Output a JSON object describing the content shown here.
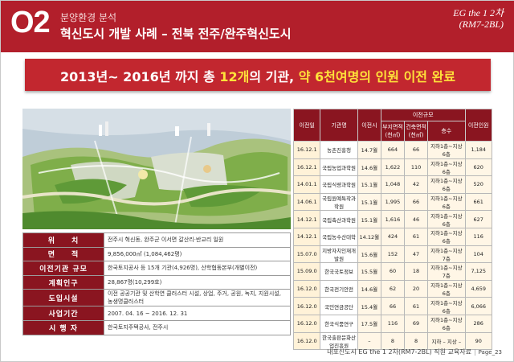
{
  "header": {
    "section_number": "O2",
    "section_subtitle": "분양환경 분석",
    "section_title": "혁신도시 개발 사례 – 전북 전주/완주혁신도시",
    "doc_code_line1": "EG the 1 2차",
    "doc_code_line2": "(RM7-2BL)"
  },
  "headline": {
    "part1": "2013년~ 2016년 까지 총 ",
    "highlight1": "12개",
    "part2": "의 기관, ",
    "highlight2": "약 6천여명의 인원  이전 완료"
  },
  "info_table": [
    {
      "label": "위　　치",
      "value": "전주시 혁신동, 완주군 이서면 갈산리·반교리 일원"
    },
    {
      "label": "면　　적",
      "value": "9,856,000㎡ (1,084,462평)"
    },
    {
      "label": "이전기관 규모",
      "value": "한국토지공사 등 15개 기관(4,926명), 산학협동본부(개별이전)"
    },
    {
      "label": "계획인구",
      "value": "28,867명(10,299호)"
    },
    {
      "label": "도입시설",
      "value": "이전 공공기관 및 산학연 클러스터 시설, 상업, 주거, 공원, 녹지, 지원시설, 농생명클러스터"
    },
    {
      "label": "사업기간",
      "value": "2007. 04. 16 ~ 2016. 12. 31"
    },
    {
      "label": "시 행 자",
      "value": "한국토지주택공사, 전주시"
    }
  ],
  "agency_table": {
    "headers": {
      "move_date": "이전일",
      "agency": "기관명",
      "move_year": "이전시",
      "scale": "이전규모",
      "land": "부지면적 (천㎡)",
      "building": "건축면적 (천㎡)",
      "floors": "층수",
      "staff": "이전인원"
    },
    "rows": [
      {
        "date": "16.12.1",
        "name": "농촌진흥청",
        "year": "14.7월",
        "land": "664",
        "building": "66",
        "floors": "지하1층~지상6층",
        "staff": "1,184"
      },
      {
        "date": "16.12.1",
        "name": "국립농업과학원",
        "year": "14.6월",
        "land": "1,622",
        "building": "110",
        "floors": "지하1층~지상6층",
        "staff": "620"
      },
      {
        "date": "14.01.1",
        "name": "국립식량과학원",
        "year": "15.1월",
        "land": "1,048",
        "building": "42",
        "floors": "지하1층~지상6층",
        "staff": "520"
      },
      {
        "date": "14.06.1",
        "name": "국립원예특작과학원",
        "year": "15.1월",
        "land": "1,995",
        "building": "66",
        "floors": "지하1층~지상6층",
        "staff": "661"
      },
      {
        "date": "14.12.1",
        "name": "국립축산과학원",
        "year": "15.1월",
        "land": "1,616",
        "building": "46",
        "floors": "지하1층~지상6층",
        "staff": "627"
      },
      {
        "date": "14.12.1",
        "name": "국립농수산대학",
        "year": "14.12월",
        "land": "424",
        "building": "61",
        "floors": "지하1층~지상6층",
        "staff": "116"
      },
      {
        "date": "15.07.0",
        "name": "지방자치인재개발원",
        "year": "15.6월",
        "land": "152",
        "building": "47",
        "floors": "지하1층~지상7층",
        "staff": "104"
      },
      {
        "date": "15.09.0",
        "name": "한국국토정보",
        "year": "15.5월",
        "land": "60",
        "building": "18",
        "floors": "지하1층~지상7층",
        "staff": "7,125"
      },
      {
        "date": "16.12.0",
        "name": "한국전기안전",
        "year": "14.6월",
        "land": "62",
        "building": "20",
        "floors": "지하1층~지상6층",
        "staff": "4,659"
      },
      {
        "date": "16.12.0",
        "name": "국민연금공단",
        "year": "15.4월",
        "land": "66",
        "building": "61",
        "floors": "지하1층~지상6층",
        "staff": "6,066"
      },
      {
        "date": "16.12.0",
        "name": "한국식품연구",
        "year": "17.5월",
        "land": "116",
        "building": "69",
        "floors": "지하1층~지상6층",
        "staff": "286"
      },
      {
        "date": "16.12.0",
        "name": "한국출판문화산업진흥원",
        "year": "–",
        "land": "8",
        "building": "8",
        "floors": "지하 – 지상 –",
        "staff": "90"
      }
    ]
  },
  "footer": {
    "doc": "내포신도시 EG the 1 2차(RM7-2BL)  직원 교육자료",
    "page": "Page_23"
  },
  "colors": {
    "header_red": "#b21f2b",
    "headline_red": "#c2272f",
    "label_maroon": "#8a1520",
    "highlight_yellow": "#ffe23a"
  }
}
